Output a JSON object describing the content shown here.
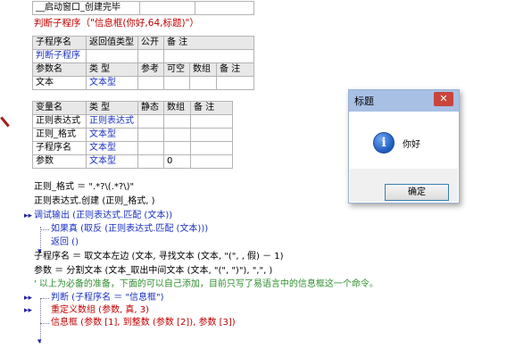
{
  "top_row": {
    "cell1": "__启动窗口_创建完毕"
  },
  "heading": "判断子程序（\"信息框(你好,64,标题)\"）",
  "sub_table": {
    "headers": [
      "子程序名",
      "返回值类型",
      "公开",
      "备 注"
    ],
    "name": "判断子程序",
    "param_headers": [
      "参数名",
      "类 型",
      "参考",
      "可空",
      "数组",
      "备 注"
    ],
    "params": [
      {
        "name": "文本",
        "type": "文本型"
      }
    ]
  },
  "var_table": {
    "headers": [
      "变量名",
      "类 型",
      "静态",
      "数组",
      "备 注"
    ],
    "rows": [
      {
        "name": "正则表达式",
        "type": "正则表达式",
        "array": ""
      },
      {
        "name": "正则_格式",
        "type": "文本型",
        "array": ""
      },
      {
        "name": "子程序名",
        "type": "文本型",
        "array": ""
      },
      {
        "name": "参数",
        "type": "文本型",
        "array": "0"
      }
    ]
  },
  "code": {
    "l1": "正则_格式 ＝ \".*?\\(.*?\\)\"",
    "l2": "正则表达式.创建 (正则_格式, )",
    "l3": "调试输出 (正则表达式.匹配 (文本))",
    "l4": "如果真 (取反 (正则表达式.匹配 (文本)))",
    "l5": "返回 ()",
    "l6": "子程序名 ＝ 取文本左边 (文本, 寻找文本 (文本, \"(\", , 假) － 1)",
    "l7": "参数 ＝ 分割文本 (文本_取出中间文本 (文本, \"(\", \")\"), \",\", )",
    "l8": "' 以上为必备的准备，下面的可以自己添加，目前只写了易语言中的信息框这一个命令。",
    "l9": "判断 (子程序名 ＝ \"信息框\")",
    "l10": "重定义数组 (参数, 真, 3)",
    "l11": "信息框 (参数 [1], 到整数 (参数 [2]), 参数 [3])"
  },
  "dialog": {
    "title": "标题",
    "close": "✕",
    "icon": "i",
    "message": "你好",
    "ok": "确定"
  }
}
